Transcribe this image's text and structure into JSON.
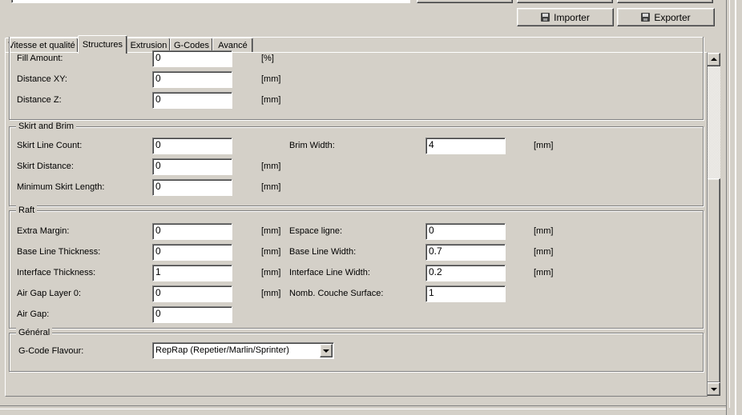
{
  "toolbar": {
    "import_label": "Importer",
    "export_label": "Exporter"
  },
  "tabs": [
    {
      "label": "Vitesse et qualité"
    },
    {
      "label": "Structures"
    },
    {
      "label": "Extrusion"
    },
    {
      "label": "G-Codes"
    },
    {
      "label": "Avancé"
    }
  ],
  "support": {
    "fill_amount": {
      "label": "Fill Amount:",
      "value": "0",
      "unit": "[%]"
    },
    "distance_xy": {
      "label": "Distance XY:",
      "value": "0",
      "unit": "[mm]"
    },
    "distance_z": {
      "label": "Distance Z:",
      "value": "0",
      "unit": "[mm]"
    }
  },
  "skirt": {
    "title": "Skirt and Brim",
    "line_count": {
      "label": "Skirt Line Count:",
      "value": "0"
    },
    "distance": {
      "label": "Skirt Distance:",
      "value": "0",
      "unit": "[mm]"
    },
    "min_length": {
      "label": "Minimum Skirt Length:",
      "value": "0",
      "unit": "[mm]"
    },
    "brim_width": {
      "label": "Brim Width:",
      "value": "4",
      "unit": "[mm]"
    }
  },
  "raft": {
    "title": "Raft",
    "extra_margin": {
      "label": "Extra Margin:",
      "value": "0",
      "unit": "[mm]"
    },
    "base_line_thickness": {
      "label": "Base Line Thickness:",
      "value": "0",
      "unit": "[mm]"
    },
    "interface_thickness": {
      "label": "Interface Thickness:",
      "value": "1",
      "unit": "[mm]"
    },
    "air_gap_layer0": {
      "label": "Air Gap Layer 0:",
      "value": "0",
      "unit": "[mm]"
    },
    "air_gap": {
      "label": "Air Gap:",
      "value": "0"
    },
    "espace_ligne": {
      "label": "Espace ligne:",
      "value": "0",
      "unit": "[mm]"
    },
    "base_line_width": {
      "label": "Base Line Width:",
      "value": "0.7",
      "unit": "[mm]"
    },
    "interface_line_width": {
      "label": "Interface Line Width:",
      "value": "0.2",
      "unit": "[mm]"
    },
    "surface_layers": {
      "label": "Nomb. Couche Surface:",
      "value": "1"
    }
  },
  "general": {
    "title": "Général",
    "gcode_flavour": {
      "label": "G-Code Flavour:",
      "value": "RepRap (Repetier/Marlin/Sprinter)"
    }
  }
}
